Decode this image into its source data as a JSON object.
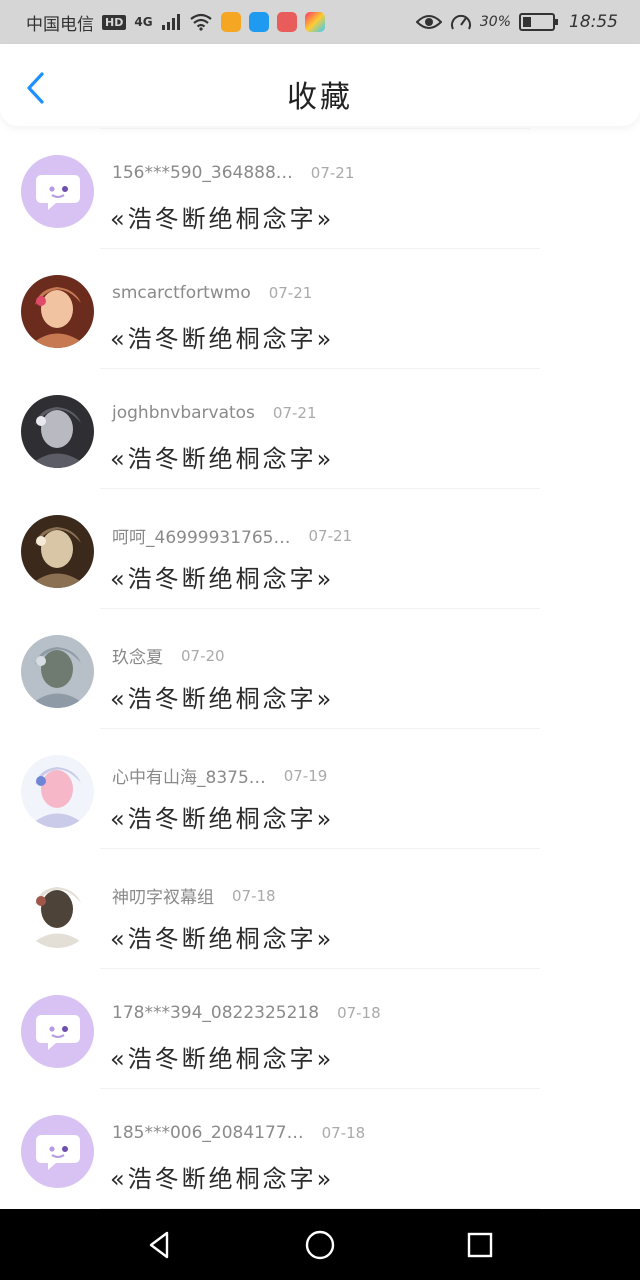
{
  "status_bar": {
    "carrier": "中国电信",
    "hd_badge": "HD",
    "network": "4G",
    "battery_percent": "30%",
    "time": "18:55",
    "icons": [
      "signal-icon",
      "wifi-icon",
      "app-icons",
      "eye-icon",
      "speed-icon",
      "battery-icon"
    ]
  },
  "header": {
    "title": "收藏",
    "back_icon": "chevron-left-icon",
    "accent_color": "#1e90ff"
  },
  "favorites": [
    {
      "username": "156***590_364888…",
      "date": "07-21",
      "quote": "«浩冬断绝桐念字»",
      "avatar": "default-chat"
    },
    {
      "username": "smcarctfortwmo",
      "date": "07-21",
      "quote": "«浩冬断绝桐念字»",
      "avatar": "photo-girl"
    },
    {
      "username": "joghbnvbarvatos",
      "date": "07-21",
      "quote": "«浩冬断绝桐念字»",
      "avatar": "photo-couple"
    },
    {
      "username": "呵呵_46999931765…",
      "date": "07-21",
      "quote": "«浩冬断绝桐念字»",
      "avatar": "photo-anime"
    },
    {
      "username": "玖念夏",
      "date": "07-20",
      "quote": "«浩冬断绝桐念字»",
      "avatar": "photo-beach"
    },
    {
      "username": "心中有山海_8375…",
      "date": "07-19",
      "quote": "«浩冬断绝桐念字»",
      "avatar": "photo-anime-girl"
    },
    {
      "username": "神叨字衩幕组",
      "date": "07-18",
      "quote": "«浩冬断绝桐念字»",
      "avatar": "photo-anime-boy"
    },
    {
      "username": "178***394_0822325218",
      "date": "07-18",
      "quote": "«浩冬断绝桐念字»",
      "avatar": "default-chat"
    },
    {
      "username": "185***006_2084177…",
      "date": "07-18",
      "quote": "«浩冬断绝桐念字»",
      "avatar": "default-chat"
    }
  ],
  "nav_bar": {
    "icons": [
      "back-triangle-icon",
      "home-circle-icon",
      "recents-square-icon"
    ]
  }
}
